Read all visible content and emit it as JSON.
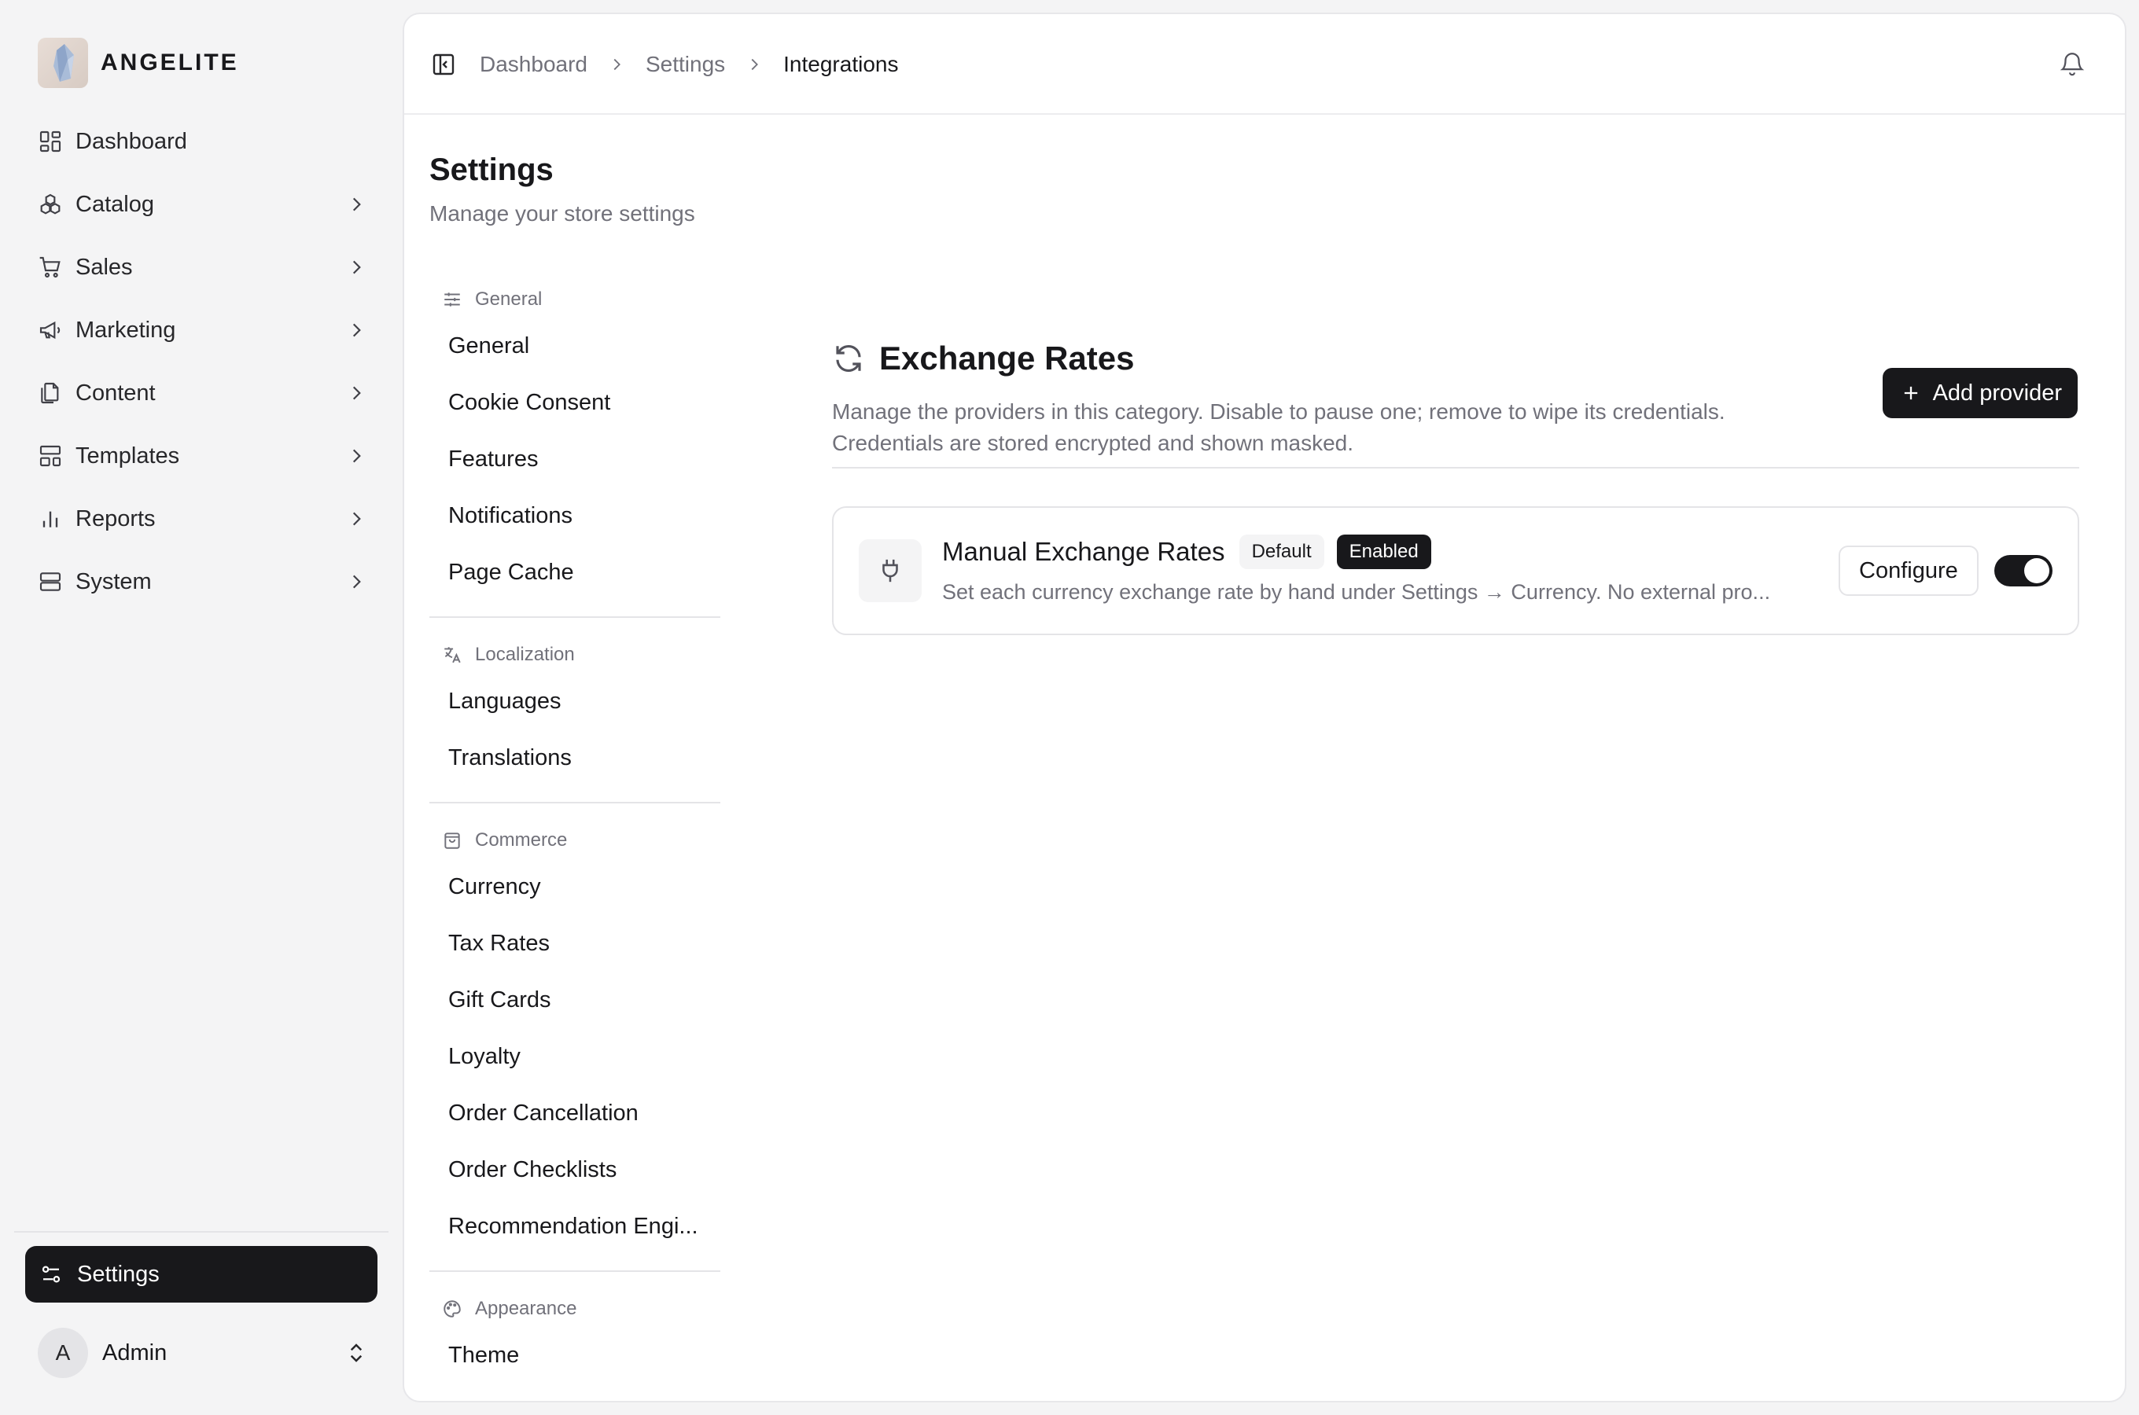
{
  "brand": {
    "name": "ANGELITE",
    "logo_icon": "crystal-logo"
  },
  "sidebar": {
    "items": [
      {
        "label": "Dashboard",
        "icon": "dashboard-icon",
        "has_chevron": false
      },
      {
        "label": "Catalog",
        "icon": "catalog-icon",
        "has_chevron": true
      },
      {
        "label": "Sales",
        "icon": "cart-icon",
        "has_chevron": true
      },
      {
        "label": "Marketing",
        "icon": "megaphone-icon",
        "has_chevron": true
      },
      {
        "label": "Content",
        "icon": "files-icon",
        "has_chevron": true
      },
      {
        "label": "Templates",
        "icon": "layout-icon",
        "has_chevron": true
      },
      {
        "label": "Reports",
        "icon": "bar-chart-icon",
        "has_chevron": true
      },
      {
        "label": "System",
        "icon": "server-icon",
        "has_chevron": true
      }
    ],
    "active": {
      "label": "Settings",
      "icon": "sliders-icon"
    },
    "user": {
      "initial": "A",
      "name": "Admin"
    }
  },
  "header": {
    "breadcrumb": [
      "Dashboard",
      "Settings",
      "Integrations"
    ]
  },
  "page": {
    "title": "Settings",
    "subtitle": "Manage your store settings"
  },
  "settings_nav": {
    "groups": [
      {
        "heading": "General",
        "icon": "sliders-horizontal-icon",
        "items": [
          "General",
          "Cookie Consent",
          "Features",
          "Notifications",
          "Page Cache"
        ]
      },
      {
        "heading": "Localization",
        "icon": "translate-icon",
        "items": [
          "Languages",
          "Translations"
        ]
      },
      {
        "heading": "Commerce",
        "icon": "shopping-bag-icon",
        "items": [
          "Currency",
          "Tax Rates",
          "Gift Cards",
          "Loyalty",
          "Order Cancellation",
          "Order Checklists",
          "Recommendation Engi..."
        ]
      },
      {
        "heading": "Appearance",
        "icon": "palette-icon",
        "items": [
          "Theme"
        ]
      }
    ]
  },
  "section": {
    "title": "Exchange Rates",
    "icon": "refresh-icon",
    "description_line1": "Manage the providers in this category. Disable to pause one; remove to wipe its credentials.",
    "description_line2": "Credentials are stored encrypted and shown masked.",
    "add_button": "Add provider"
  },
  "providers": [
    {
      "name": "Manual Exchange Rates",
      "badges": [
        "Default",
        "Enabled"
      ],
      "description": "Set each currency exchange rate by hand under Settings → Currency. No external pro...",
      "configure_label": "Configure",
      "enabled": true,
      "icon": "plug-icon"
    }
  ],
  "colors": {
    "primary": "#18181b",
    "muted_text": "#71717a",
    "border": "#e4e4e7",
    "background": "#f4f4f5"
  }
}
